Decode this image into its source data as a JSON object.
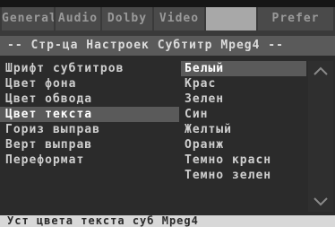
{
  "tabs": [
    {
      "label": "General"
    },
    {
      "label": "Audio"
    },
    {
      "label": "Dolby"
    },
    {
      "label": "Video"
    },
    {
      "label": ""
    },
    {
      "label": "Prefer"
    }
  ],
  "header": {
    "title": "-- Стр-ца Настроек Субтитр Mpeg4 --"
  },
  "left_menu": {
    "items": [
      {
        "label": "Шрифт субтитров"
      },
      {
        "label": "Цвет фона"
      },
      {
        "label": "Цвет обвода"
      },
      {
        "label": "Цвет текста"
      },
      {
        "label": "Гориз выправ"
      },
      {
        "label": "Верт выправ"
      },
      {
        "label": "Переформат"
      }
    ],
    "selected_index": 3
  },
  "options": {
    "items": [
      {
        "label": "Белый"
      },
      {
        "label": "Крас"
      },
      {
        "label": "Зелен"
      },
      {
        "label": "Син"
      },
      {
        "label": "Желтый"
      },
      {
        "label": "Оранж"
      },
      {
        "label": "Темно красн"
      },
      {
        "label": "Темно зелен"
      }
    ],
    "selected_index": 0
  },
  "status_bar": {
    "text": "Уст цвета текста суб Mpeg4"
  },
  "colors": {
    "background": "#2b2b2b",
    "selected_row": "#5a5a5a",
    "selected_tab": "#a8a8a8",
    "status_bar": "#d8d8d8"
  }
}
